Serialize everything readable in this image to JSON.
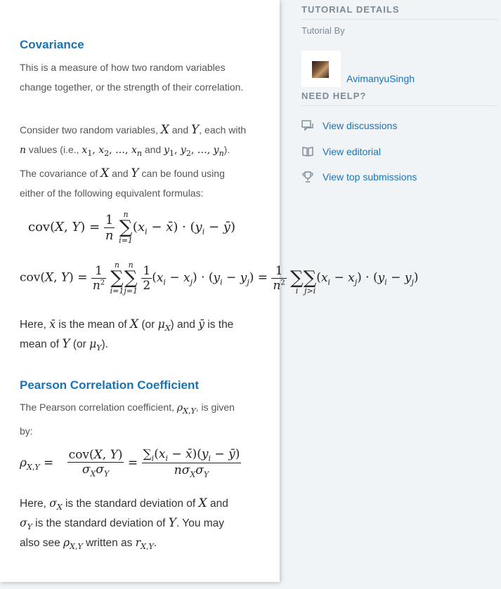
{
  "main": {
    "covariance": {
      "title": "Covariance",
      "intro_line1": "This is a measure of how two random variables",
      "intro_line2": "change together, or the strength of their correlation.",
      "consider_a": "Consider two random variables, ",
      "consider_b": " and ",
      "consider_c": ", each with",
      "values_a": " values (i.e., ",
      "values_b": " and ",
      "values_c": ").",
      "cov_a": "The covariance of ",
      "cov_b": " and ",
      "cov_c": " can be found using",
      "either": "either of the following equivalent formulas:",
      "here_a": "Here, ",
      "here_b": " is the mean of ",
      "here_c": " (or ",
      "here_d": ") and ",
      "here_e": " is the",
      "mean_a": "mean of ",
      "mean_b": " (or ",
      "mean_c": ")."
    },
    "pearson": {
      "title": "Pearson Correlation Coefficient",
      "line1_a": "The Pearson correlation coefficient, ",
      "line1_b": ", is given",
      "line2": "by:",
      "here_a": "Here, ",
      "here_b": " is the standard deviation of ",
      "here_c": " and",
      "sd_b": " is the standard deviation of ",
      "sd_c": ". You may",
      "also_a": "also see ",
      "also_b": " written as ",
      "also_c": "."
    }
  },
  "sidebar": {
    "tutorial_details": "TUTORIAL DETAILS",
    "tutorial_by": "Tutorial By",
    "author": "AvimanyuSingh",
    "need_help": "NEED HELP?",
    "links": [
      {
        "label": "View discussions",
        "icon": "discussion-icon"
      },
      {
        "label": "View editorial",
        "icon": "book-icon"
      },
      {
        "label": "View top submissions",
        "icon": "trophy-icon"
      }
    ]
  },
  "colors": {
    "accent": "#1a73b5",
    "muted": "#7b8a96",
    "background": "#f1f4f6"
  }
}
